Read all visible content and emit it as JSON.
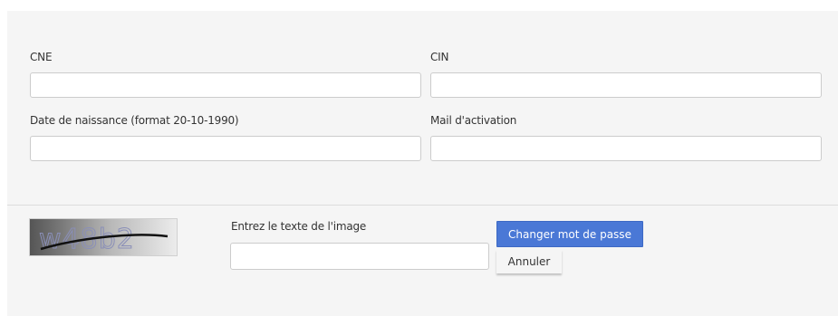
{
  "form": {
    "cne": {
      "label": "CNE",
      "value": ""
    },
    "cin": {
      "label": "CIN",
      "value": ""
    },
    "birthdate": {
      "label": "Date de naissance (format 20-10-1990)",
      "value": ""
    },
    "activation_mail": {
      "label": "Mail d'activation",
      "value": ""
    }
  },
  "captcha": {
    "image_icon": "captcha-image",
    "text": "w48b2",
    "input_label": "Entrez le texte de l'image",
    "input_value": ""
  },
  "actions": {
    "submit_label": "Changer mot de passe",
    "cancel_label": "Annuler"
  },
  "colors": {
    "primary_button": "#4a78d6",
    "panel_background": "#f5f5f5"
  }
}
